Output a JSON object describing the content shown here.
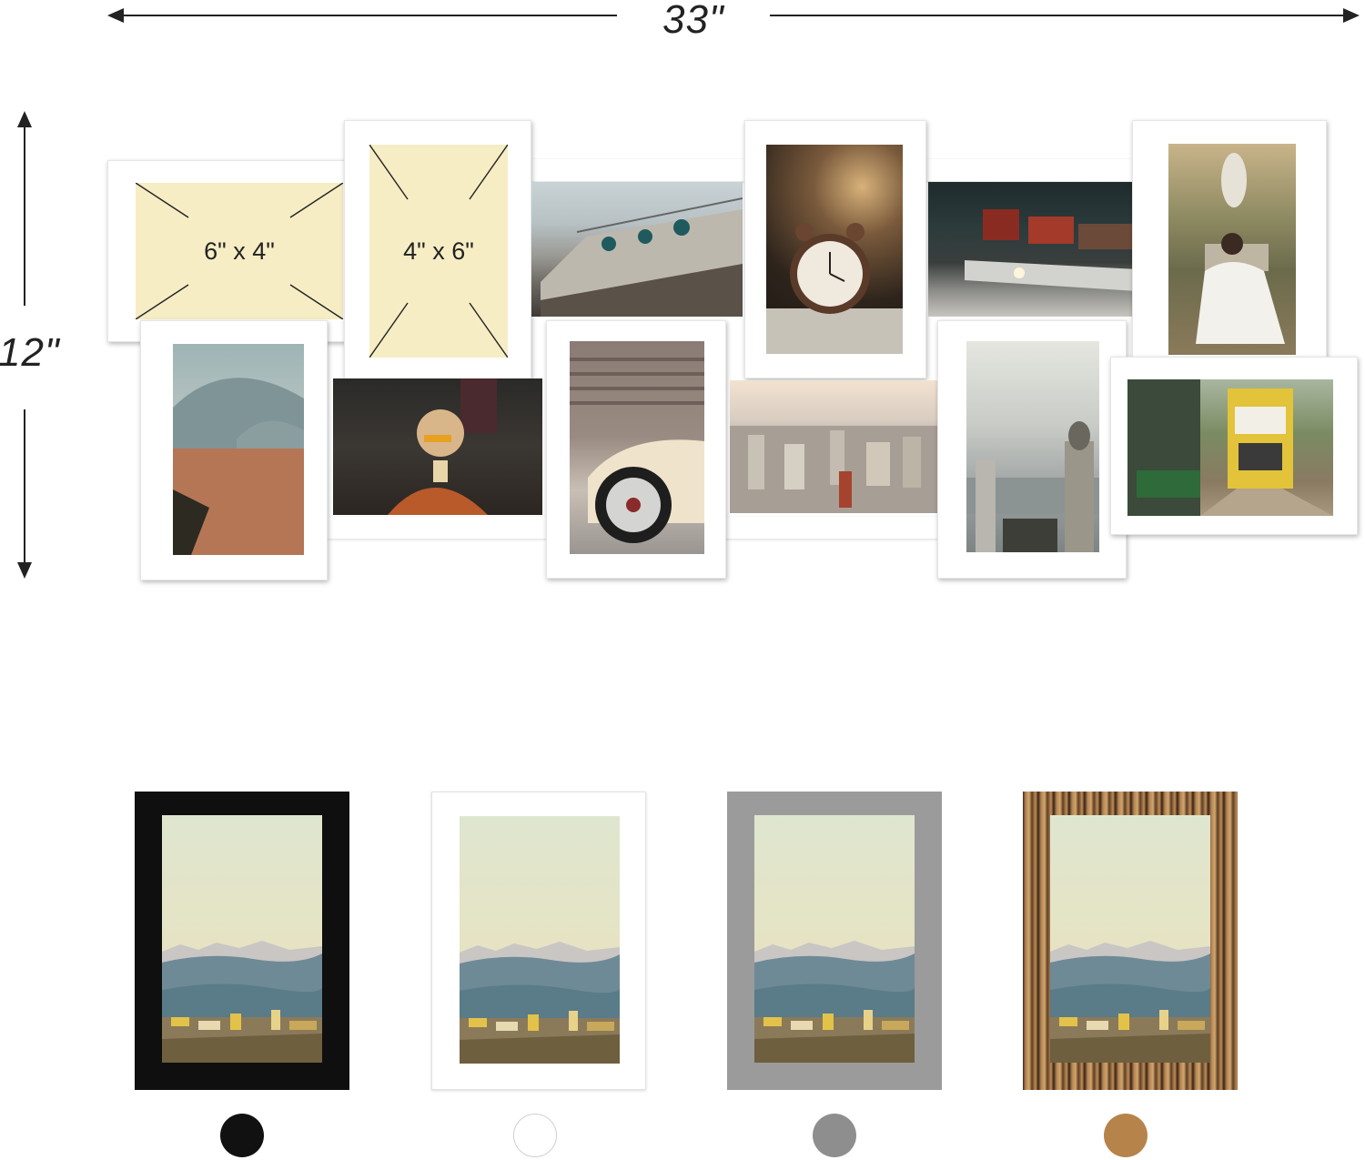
{
  "dimensions": {
    "width_label": "33\"",
    "height_label": "12\""
  },
  "collage": {
    "frame_color": "#ffffff",
    "placeholders": [
      {
        "label": "6\" x 4\""
      },
      {
        "label": "4\" x 6\""
      }
    ],
    "photos": [
      {
        "subject": "building-facade-photo"
      },
      {
        "subject": "alarm-clock-photo"
      },
      {
        "subject": "vintage-car-taillight-photo"
      },
      {
        "subject": "woman-white-dress-statue-photo"
      },
      {
        "subject": "mosque-dome-photo"
      },
      {
        "subject": "woman-drinking-photo"
      },
      {
        "subject": "classic-car-wheel-photo"
      },
      {
        "subject": "city-skyline-photo"
      },
      {
        "subject": "bosphorus-monument-photo"
      },
      {
        "subject": "yellow-tram-photo"
      }
    ]
  },
  "color_options": [
    {
      "name": "black",
      "color": "#111111"
    },
    {
      "name": "white",
      "color": "#ffffff"
    },
    {
      "name": "gray",
      "color": "#8e8e8e"
    },
    {
      "name": "rustic-brown",
      "color": "#b6834b"
    }
  ]
}
